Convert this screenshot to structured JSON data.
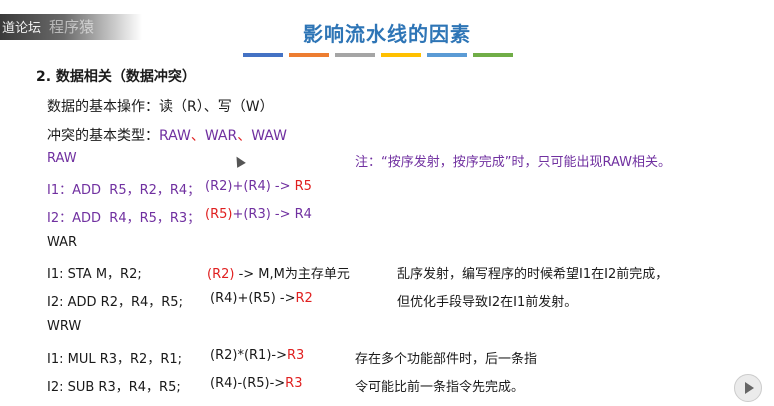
{
  "watermark": {
    "text": "道论坛",
    "ghost": "程序猿"
  },
  "title": "影响流水线的因素",
  "accent_bars": [
    "#4472c4",
    "#ed7d31",
    "#a5a5a5",
    "#ffc000",
    "#5b9bd5",
    "#70ad47"
  ],
  "heading": "2. 数据相关（数据冲突）",
  "basic_ops": "数据的基本操作：读（R）、写（W）",
  "conflict_types": {
    "prefix": "冲突的基本类型：",
    "raw": "RAW",
    "sep": "、",
    "war": "WAR",
    "waw": "WAW"
  },
  "raw": {
    "label": "RAW",
    "note": "注：“按序发射，按序完成”时，只可能出现RAW相关。",
    "i1": {
      "instr": "I1：ADD  R5，R2，R4；",
      "expr_pre": "(R2)+(R4) -> ",
      "expr_dst": "R5"
    },
    "i2": {
      "instr": "I2：ADD  R4，R5，R3；",
      "expr_src": "(R5)",
      "expr_post": "+(R3) -> R4"
    }
  },
  "war": {
    "label": "WAR",
    "i1": {
      "instr": "I1: STA M，R2;",
      "expr_src": "(R2)",
      "expr_post": " -> M,M为主存单元"
    },
    "i2": {
      "instr": "I2: ADD R2，R4，R5;",
      "expr_pre": "(R4)+(R5) ->",
      "expr_dst": "R2"
    },
    "note1": "乱序发射，编写程序的时候希望I1在I2前完成，",
    "note2": "但优化手段导致I2在I1前发射。"
  },
  "waw": {
    "label": "WRW",
    "i1": {
      "instr": "I1: MUL R3，R2，R1;",
      "expr_pre": "(R2)*(R1)->",
      "expr_dst": "R3"
    },
    "i2": {
      "instr": "I2: SUB R3，R4，R5;",
      "expr_pre": "(R4)-(R5)->",
      "expr_dst": "R3"
    },
    "note1": "存在多个功能部件时，后一条指",
    "note2": "令可能比前一条指令先完成。"
  },
  "icons": {
    "cursor": "mouse-pointer-icon",
    "player": "play-button-icon"
  }
}
